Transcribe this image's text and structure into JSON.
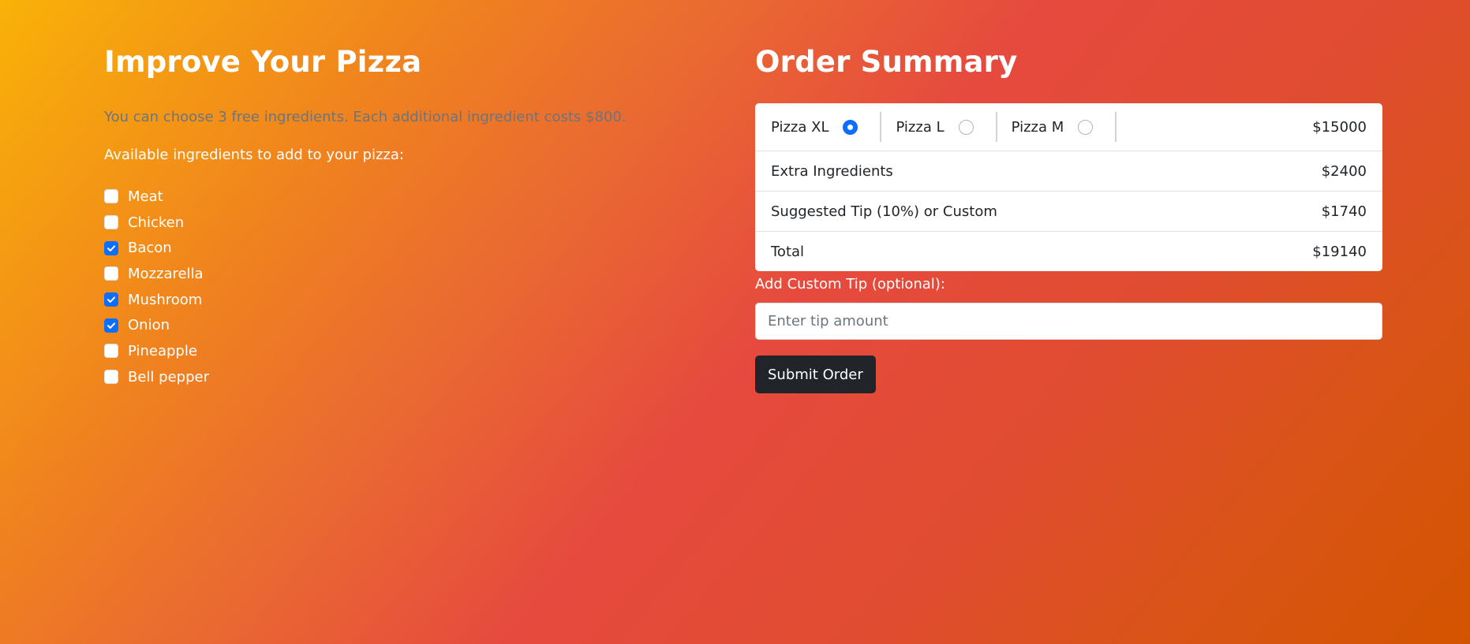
{
  "left": {
    "title": "Improve Your Pizza",
    "info": "You can choose 3 free ingredients. Each additional ingredient costs $800.",
    "available_label": "Available ingredients to add to your pizza:",
    "ingredients": [
      {
        "label": "Meat",
        "checked": false
      },
      {
        "label": "Chicken",
        "checked": false
      },
      {
        "label": "Bacon",
        "checked": true
      },
      {
        "label": "Mozzarella",
        "checked": false
      },
      {
        "label": "Mushroom",
        "checked": true
      },
      {
        "label": "Onion",
        "checked": true
      },
      {
        "label": "Pineapple",
        "checked": false
      },
      {
        "label": "Bell pepper",
        "checked": false
      }
    ]
  },
  "summary": {
    "title": "Order Summary",
    "sizes": [
      {
        "label": "Pizza XL",
        "selected": true
      },
      {
        "label": "Pizza L",
        "selected": false
      },
      {
        "label": "Pizza M",
        "selected": false
      }
    ],
    "pizza_price": "$15000",
    "extra_label": "Extra Ingredients",
    "extra_price": "$2400",
    "tip_label": "Suggested Tip (10%) or Custom",
    "tip_price": "$1740",
    "total_label": "Total",
    "total_price": "$19140"
  },
  "custom_tip": {
    "label": "Add Custom Tip (optional):",
    "placeholder": "Enter tip amount",
    "value": ""
  },
  "submit_label": "Submit Order",
  "colors": {
    "accent": "#0d6efd",
    "button_bg": "#212529",
    "muted_text": "#6c757d"
  }
}
